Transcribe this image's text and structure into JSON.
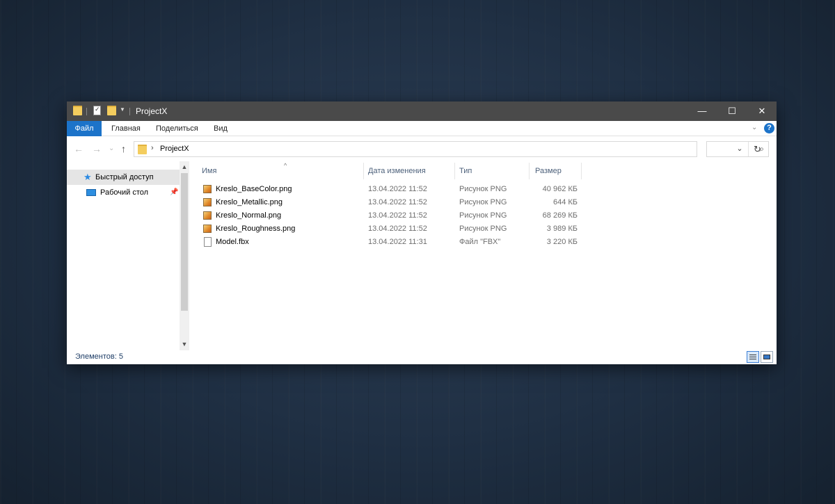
{
  "window": {
    "title": "ProjectX",
    "caption": {
      "minimize": "—",
      "maximize": "☐",
      "close": "✕"
    }
  },
  "ribbon": {
    "tabs": [
      "Файл",
      "Главная",
      "Поделиться",
      "Вид"
    ],
    "help": "?",
    "collapse": "⌄"
  },
  "navigation": {
    "back": "←",
    "forward": "→",
    "recent": "⌄",
    "up": "↑",
    "chevron": "›",
    "address": "ProjectX",
    "dropdown": "⌄",
    "refresh": "↻",
    "search_placeholder": "",
    "search_icon": "⌕"
  },
  "navpane": {
    "items": [
      {
        "label": "Быстрый доступ",
        "icon": "star-icon",
        "selected": true
      },
      {
        "label": "Рабочий стол",
        "icon": "desktop-icon",
        "pinned": true
      }
    ],
    "pin": "📌",
    "scroll_up": "▲",
    "scroll_down": "▼"
  },
  "filelist": {
    "columns": [
      "Имя",
      "Дата изменения",
      "Тип",
      "Размер"
    ],
    "sort_indicator": "^",
    "files": [
      {
        "name": "Kreslo_BaseColor.png",
        "date": "13.04.2022 11:52",
        "type": "Рисунок PNG",
        "size": "40 962 КБ",
        "icon": "png-icon"
      },
      {
        "name": "Kreslo_Metallic.png",
        "date": "13.04.2022 11:52",
        "type": "Рисунок PNG",
        "size": "644 КБ",
        "icon": "png-icon"
      },
      {
        "name": "Kreslo_Normal.png",
        "date": "13.04.2022 11:52",
        "type": "Рисунок PNG",
        "size": "68 269 КБ",
        "icon": "png-icon"
      },
      {
        "name": "Kreslo_Roughness.png",
        "date": "13.04.2022 11:52",
        "type": "Рисунок PNG",
        "size": "3 989 КБ",
        "icon": "png-icon"
      },
      {
        "name": "Model.fbx",
        "date": "13.04.2022 11:31",
        "type": "Файл \"FBX\"",
        "size": "3 220 КБ",
        "icon": "file-icon"
      }
    ]
  },
  "status": {
    "items_count": "Элементов: 5"
  },
  "colors": {
    "titlebar": "#4a4a4a",
    "accent": "#1c73c9",
    "column_header": "#4c607a",
    "status_text": "#1e3d66"
  }
}
